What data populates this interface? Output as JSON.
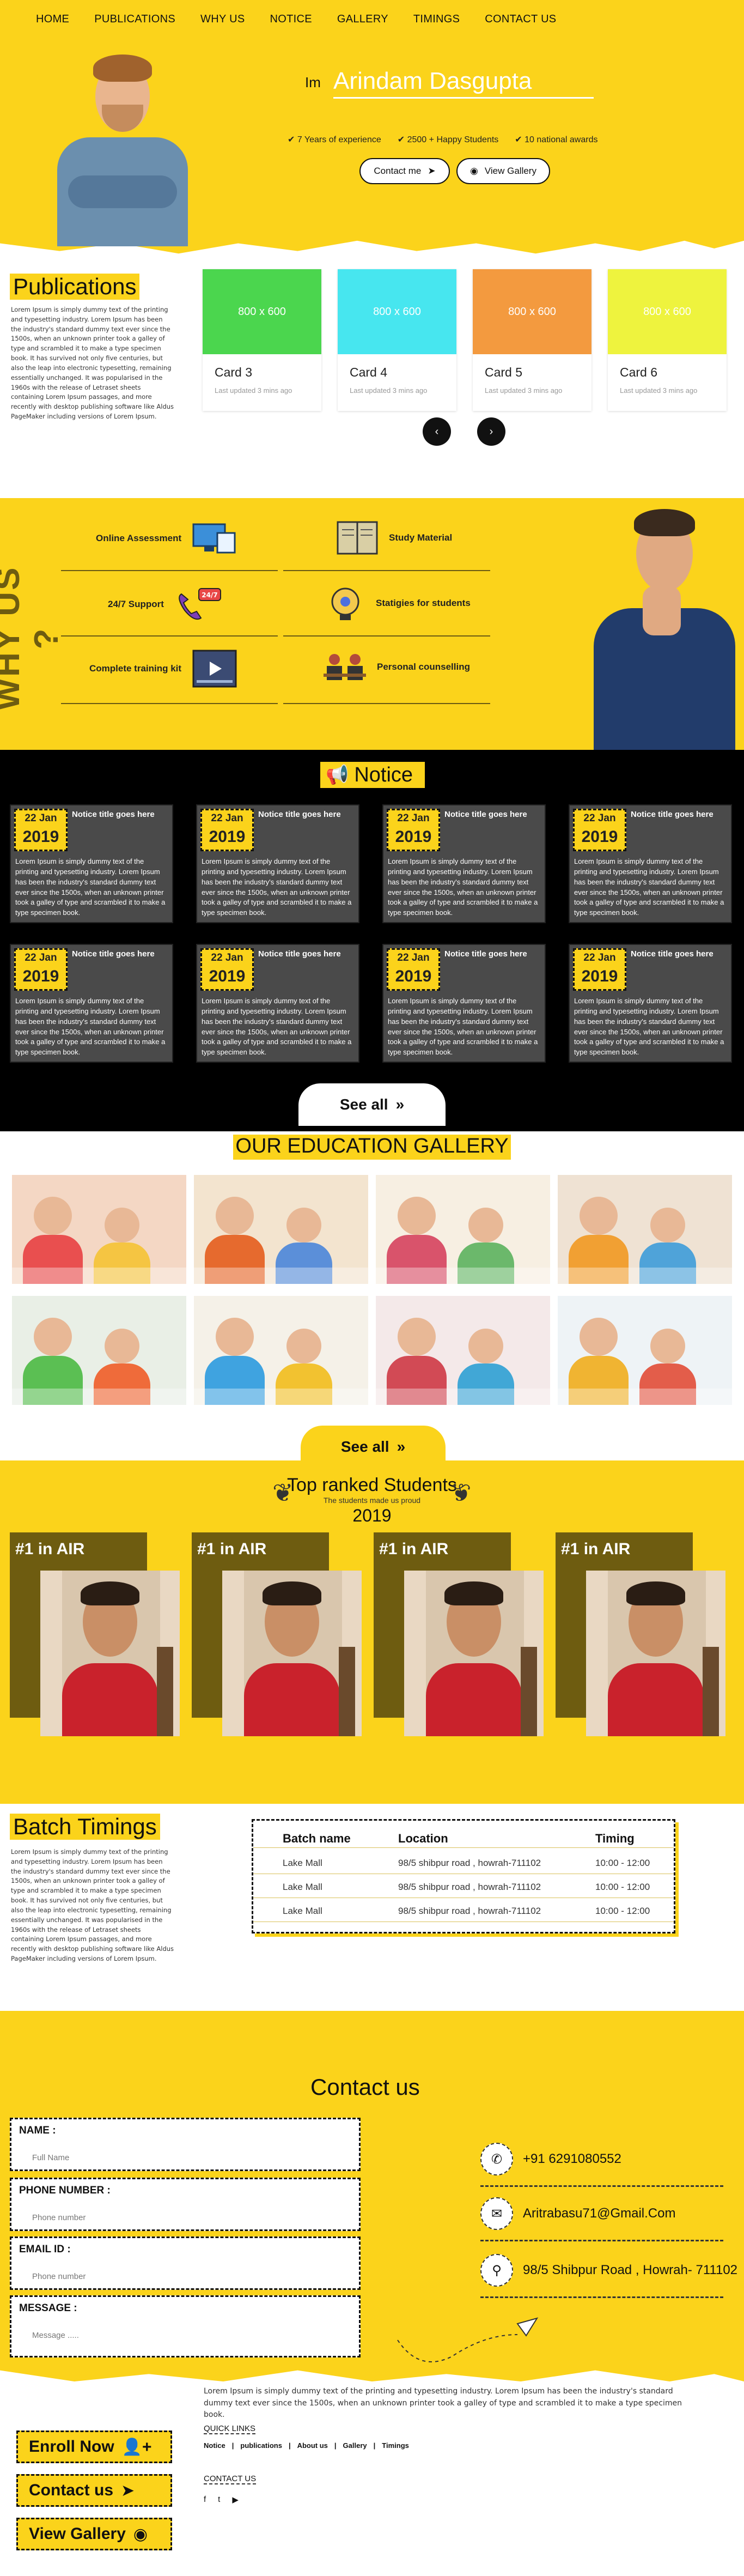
{
  "nav": [
    "HOME",
    "PUBLICATIONS",
    "WHY US",
    "NOTICE",
    "GALLERY",
    "TIMINGS",
    "CONTACT US"
  ],
  "hero": {
    "prefix": "Im",
    "name": "Arindam Dasgupta",
    "stats": [
      "7 Years of experience",
      "2500 + Happy Students",
      "10 national awards"
    ],
    "btn_contact": "Contact me",
    "btn_gallery": "View Gallery"
  },
  "publications": {
    "title": "Publications",
    "text": "Lorem Ipsum is simply dummy text of the printing and typesetting industry. Lorem Ipsum has been the industry's standard dummy text ever since the 1500s, when an unknown printer took a galley of type and scrambled it to make a type specimen book. It has survived not only five centuries, but also the leap into electronic typesetting, remaining essentially unchanged. It was popularised in the 1960s with the release of Letraset sheets containing Lorem Ipsum passages, and more recently with desktop publishing software like Aldus PageMaker including versions of Lorem Ipsum.",
    "cards": [
      {
        "img": "800 x 600",
        "title": "Card 3",
        "sub": "Last updated 3 mins ago",
        "color": "#4bd64e"
      },
      {
        "img": "800 x 600",
        "title": "Card 4",
        "sub": "Last updated 3 mins ago",
        "color": "#47e6ef"
      },
      {
        "img": "800 x 600",
        "title": "Card 5",
        "sub": "Last updated 3 mins ago",
        "color": "#f39a3f"
      },
      {
        "img": "800 x 600",
        "title": "Card 6",
        "sub": "Last updated 3 mins ago",
        "color": "#eef33e"
      }
    ],
    "prev": "‹",
    "next": "›"
  },
  "whyus": {
    "title": "WHY US ?",
    "items": [
      "Online Assessment",
      "Study Material",
      "24/7 Support",
      "Statigies for students",
      "Complete training kit",
      "Personal counselling"
    ],
    "badge": "24/7"
  },
  "notice": {
    "title": "Notice",
    "cards": [
      {
        "day": "22 Jan",
        "year": "2019",
        "title": "Notice title goes here",
        "body": "Lorem Ipsum is simply dummy text of the printing and typesetting industry. Lorem Ipsum has been the industry's standard dummy text ever since the 1500s, when an unknown printer took a galley of type and scrambled it to make a type specimen book."
      }
    ],
    "see_all": "See all"
  },
  "gallery": {
    "title": "OUR EDUCATION GALLERY",
    "see_all": "See all"
  },
  "ranked": {
    "title": "Top ranked Students",
    "sub": "The students made us proud",
    "year": "2019",
    "label": "#1 in AIR"
  },
  "timings": {
    "title": "Batch Timings",
    "text": "Lorem Ipsum is simply dummy text of the printing and typesetting industry. Lorem Ipsum has been the industry's standard dummy text ever since the 1500s, when an unknown printer took a galley of type and scrambled it to make a type specimen book. It has survived not only five centuries, but also the leap into electronic typesetting, remaining essentially unchanged. It was popularised in the 1960s with the release of Letraset sheets containing Lorem Ipsum passages, and more recently with desktop publishing software like Aldus PageMaker including versions of Lorem Ipsum.",
    "headers": [
      "Batch name",
      "Location",
      "Timing"
    ],
    "rows": [
      [
        "Lake Mall",
        "98/5 shibpur road , howrah-711102",
        "10:00 - 12:00"
      ],
      [
        "Lake Mall",
        "98/5 shibpur road , howrah-711102",
        "10:00 - 12:00"
      ],
      [
        "Lake Mall",
        "98/5 shibpur road , howrah-711102",
        "10:00 - 12:00"
      ]
    ]
  },
  "contact": {
    "title": "Contact us",
    "fields": [
      {
        "label": "NAME :",
        "placeholder": "Full Name"
      },
      {
        "label": "PHONE NUMBER :",
        "placeholder": "Phone number"
      },
      {
        "label": "EMAIL ID :",
        "placeholder": "Phone number"
      },
      {
        "label": "MESSAGE :",
        "placeholder": "Message ....."
      }
    ],
    "phone": "+91 6291080552",
    "email": "Aritrabasu71@Gmail.Com",
    "address": "98/5 Shibpur Road , Howrah- 711102"
  },
  "footer": {
    "btn_enroll": "Enroll Now",
    "btn_contact": "Contact us",
    "btn_gallery": "View Gallery",
    "text": "Lorem Ipsum is simply dummy text of the printing and typesetting industry. Lorem Ipsum has been the industry's standard dummy text ever since the 1500s, when an unknown printer took a galley of type and scrambled it to make a type specimen book.",
    "quick_title": "QUICK LINKS",
    "quick_links": [
      "Notice",
      "publications",
      "About us",
      "Gallery",
      "Timings"
    ],
    "contact_title": "CONTACT US",
    "socials": [
      "f",
      "t",
      "▶"
    ]
  }
}
